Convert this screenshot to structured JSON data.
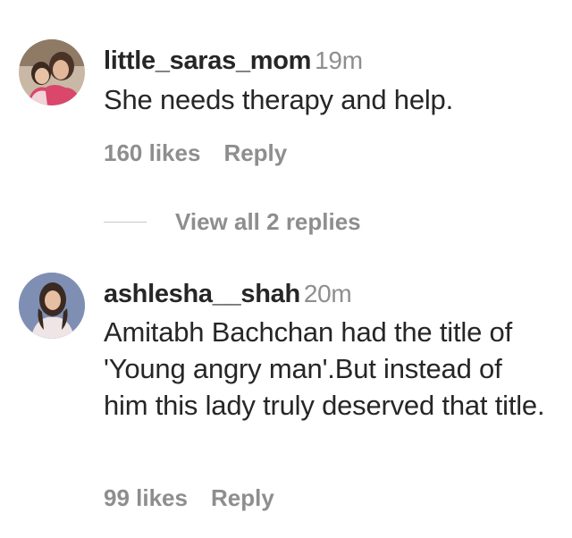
{
  "comments": [
    {
      "username": "little_saras_mom",
      "time": "19m",
      "text": "She needs therapy and help.",
      "likes": "160 likes",
      "reply_label": "Reply",
      "avatar_icon": "profile-photo-mother-daughter"
    },
    {
      "username": "ashlesha__shah",
      "time": "20m",
      "text": "Amitabh Bachchan had the title of 'Young angry man'.But instead of him this lady truly deserved that title.",
      "likes": "99 likes",
      "reply_label": "Reply",
      "avatar_icon": "profile-photo-woman"
    }
  ],
  "view_replies": {
    "label": "View all 2 replies"
  },
  "colors": {
    "text": "#262626",
    "muted": "#8e8e8e",
    "divider": "#c7c7c7"
  }
}
